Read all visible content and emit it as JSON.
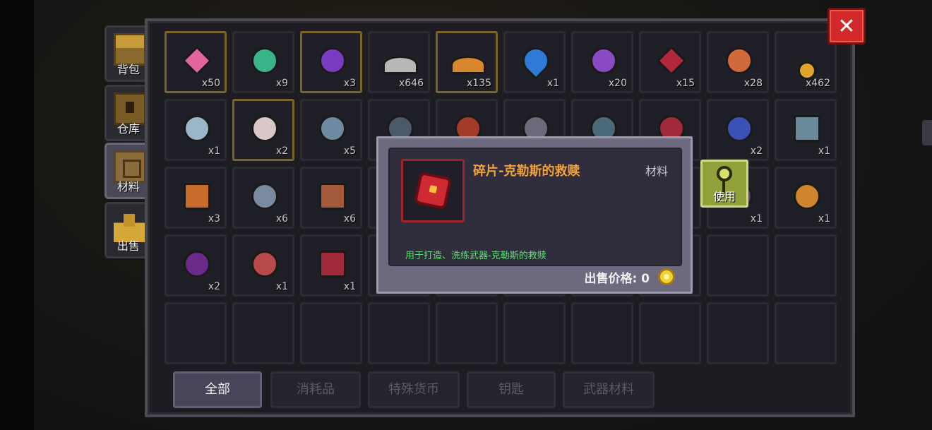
{
  "side_tabs": [
    {
      "label": "背包",
      "active": false,
      "icon": "chest-icon"
    },
    {
      "label": "仓库",
      "active": false,
      "icon": "storage-icon"
    },
    {
      "label": "材料",
      "active": true,
      "icon": "materials-icon"
    },
    {
      "label": "出售",
      "active": false,
      "icon": "sell-icon"
    }
  ],
  "grid": {
    "rows": [
      [
        {
          "count": "x50",
          "icon": "pink-gem-icon",
          "color": "#e2659e",
          "gold": true
        },
        {
          "count": "x9",
          "icon": "green-coin-icon",
          "color": "#38b38a",
          "gold": false
        },
        {
          "count": "x3",
          "icon": "purple-c-coin-icon",
          "color": "#7a3ac2",
          "gold": true
        },
        {
          "count": "x646",
          "icon": "silver-ore-pile-icon",
          "color": "#b8b8b8",
          "gold": false
        },
        {
          "count": "x135",
          "icon": "gold-ore-pile-icon",
          "color": "#d9862c",
          "gold": true
        },
        {
          "count": "x1",
          "icon": "blue-key-drop-icon",
          "color": "#2e7ad6",
          "gold": false
        },
        {
          "count": "x20",
          "icon": "purple-token-icon",
          "color": "#8a4ac2",
          "gold": false
        },
        {
          "count": "x15",
          "icon": "red-crystal-icon",
          "color": "#b0283a",
          "gold": false
        },
        {
          "count": "x28",
          "icon": "orange-wrench-icon",
          "color": "#d06a3a",
          "gold": false
        },
        {
          "count": "x462",
          "icon": "medal-icon",
          "color": "#e2a22c",
          "gold": false
        }
      ],
      [
        {
          "count": "x1",
          "icon": "robot-head-icon",
          "color": "#9ab6c8",
          "gold": false
        },
        {
          "count": "x2",
          "icon": "statue-icon",
          "color": "#d8c8c8",
          "gold": true
        },
        {
          "count": "x5",
          "icon": "sword-part-icon",
          "color": "#6e8aa2",
          "gold": false
        },
        {
          "count": "",
          "icon": "item-icon",
          "color": "#4a5a6a",
          "gold": false
        },
        {
          "count": "",
          "icon": "item-icon",
          "color": "#a33a2a",
          "gold": false
        },
        {
          "count": "",
          "icon": "item-icon",
          "color": "#6a6a7a",
          "gold": false
        },
        {
          "count": "",
          "icon": "item-icon",
          "color": "#4a6a7a",
          "gold": false
        },
        {
          "count": "",
          "icon": "item-icon",
          "color": "#a02a3a",
          "gold": false
        },
        {
          "count": "x2",
          "icon": "blue-fish-icon",
          "color": "#3a52b8",
          "gold": false
        },
        {
          "count": "x1",
          "icon": "pipe-icon",
          "color": "#6a8a9a",
          "gold": false
        }
      ],
      [
        {
          "count": "x3",
          "icon": "orange-block-icon",
          "color": "#c86a2c",
          "gold": false
        },
        {
          "count": "x6",
          "icon": "blob-icon",
          "color": "#7a8aa0",
          "gold": false
        },
        {
          "count": "x6",
          "icon": "scroll-icon",
          "color": "#a25a3a",
          "gold": false
        },
        {
          "count": "",
          "icon": "",
          "color": "",
          "gold": false
        },
        {
          "count": "",
          "icon": "",
          "color": "",
          "gold": false
        },
        {
          "count": "",
          "icon": "",
          "color": "",
          "gold": false
        },
        {
          "count": "",
          "icon": "",
          "color": "",
          "gold": false
        },
        {
          "count": "",
          "icon": "",
          "color": "",
          "gold": false
        },
        {
          "count": "x1",
          "icon": "purple-item-icon",
          "color": "#5a3a6a",
          "gold": false
        },
        {
          "count": "x1",
          "icon": "orange-ring-icon",
          "color": "#d0842c",
          "gold": false
        }
      ],
      [
        {
          "count": "x2",
          "icon": "purple-whip-icon",
          "color": "#6a2a8a",
          "gold": false
        },
        {
          "count": "x1",
          "icon": "horn-icon",
          "color": "#b84a4a",
          "gold": false
        },
        {
          "count": "x1",
          "icon": "red-shield-icon",
          "color": "#a02a3a",
          "gold": false
        },
        {
          "count": "",
          "icon": "",
          "color": "",
          "gold": false
        },
        {
          "count": "",
          "icon": "",
          "color": "",
          "gold": false
        },
        {
          "count": "",
          "icon": "",
          "color": "",
          "gold": false
        },
        {
          "count": "",
          "icon": "",
          "color": "",
          "gold": false
        },
        {
          "count": "",
          "icon": "",
          "color": "",
          "gold": false
        },
        {
          "count": "",
          "icon": "",
          "color": "",
          "gold": false
        },
        {
          "count": "",
          "icon": "",
          "color": "",
          "gold": false
        }
      ],
      [
        {
          "count": "",
          "icon": "",
          "color": "",
          "gold": false
        },
        {
          "count": "",
          "icon": "",
          "color": "",
          "gold": false
        },
        {
          "count": "",
          "icon": "",
          "color": "",
          "gold": false
        },
        {
          "count": "",
          "icon": "",
          "color": "",
          "gold": false
        },
        {
          "count": "",
          "icon": "",
          "color": "",
          "gold": false
        },
        {
          "count": "",
          "icon": "",
          "color": "",
          "gold": false
        },
        {
          "count": "",
          "icon": "",
          "color": "",
          "gold": false
        },
        {
          "count": "",
          "icon": "",
          "color": "",
          "gold": false
        },
        {
          "count": "",
          "icon": "",
          "color": "",
          "gold": false
        },
        {
          "count": "",
          "icon": "",
          "color": "",
          "gold": false
        }
      ]
    ]
  },
  "tooltip": {
    "title": "碎片-克勒斯的救赎",
    "type": "材料",
    "description": "用于打造、洗练武器-克勒斯的救赎",
    "price_text": "出售价格: 0",
    "icon": "red-fragment-icon",
    "coin_icon": "gold-coin-icon"
  },
  "use_button": {
    "label": "使用",
    "icon": "key-icon"
  },
  "close_button": {
    "label": "✕"
  },
  "bottom_tabs": [
    {
      "label": "全部",
      "active": true
    },
    {
      "label": "消耗品",
      "active": false
    },
    {
      "label": "特殊货币",
      "active": false
    },
    {
      "label": "钥匙",
      "active": false
    },
    {
      "label": "武器材料",
      "active": false
    }
  ]
}
